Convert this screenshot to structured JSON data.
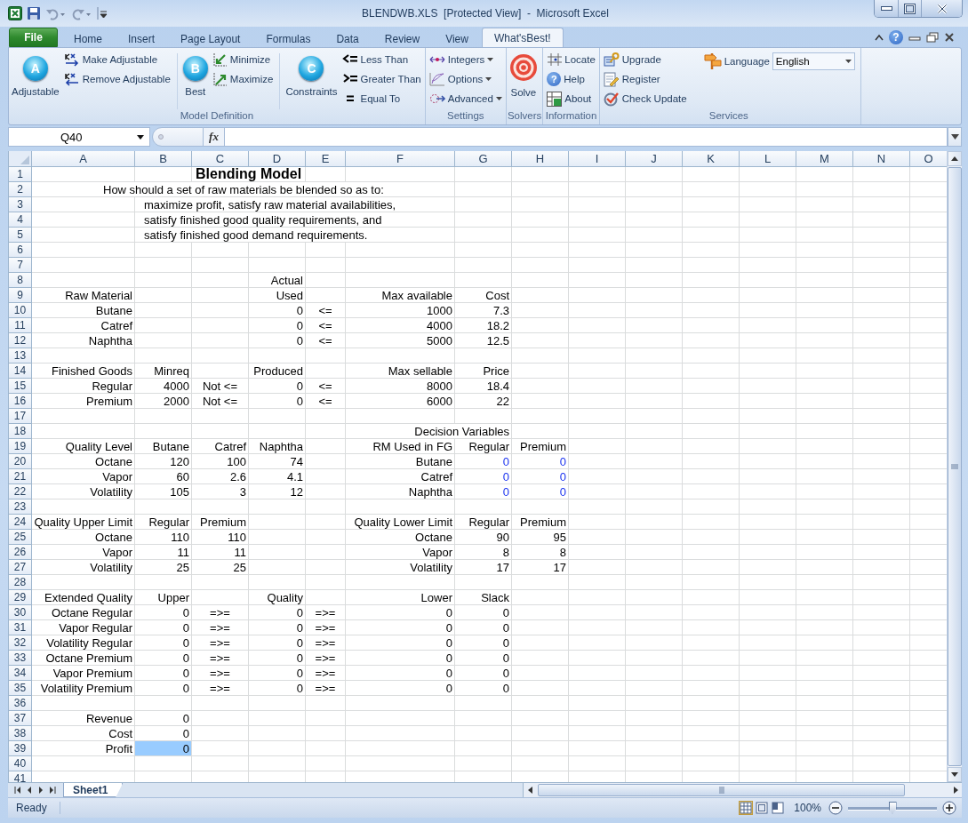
{
  "window": {
    "title": "BLENDWB.XLS  [Protected View]  -  Microsoft Excel"
  },
  "ribbon": {
    "tabs": [
      {
        "label": "File",
        "kind": "file",
        "selected": false
      },
      {
        "label": "Home",
        "kind": "tab",
        "selected": false
      },
      {
        "label": "Insert",
        "kind": "tab",
        "selected": false
      },
      {
        "label": "Page Layout",
        "kind": "tab",
        "selected": false
      },
      {
        "label": "Formulas",
        "kind": "tab",
        "selected": false
      },
      {
        "label": "Data",
        "kind": "tab",
        "selected": false
      },
      {
        "label": "Review",
        "kind": "tab",
        "selected": false
      },
      {
        "label": "View",
        "kind": "tab",
        "selected": false
      },
      {
        "label": "What'sBest!",
        "kind": "tab",
        "selected": true
      }
    ],
    "help_glyph": "?",
    "groups": [
      {
        "label": "Model Definition",
        "controls": [
          {
            "kind": "large",
            "label": "Adjustable",
            "glyph": "A"
          },
          {
            "kind": "stack",
            "buttons": [
              {
                "label": "Make Adjustable"
              },
              {
                "label": "Remove Adjustable"
              }
            ]
          },
          {
            "kind": "separator"
          },
          {
            "kind": "large",
            "label": "Best",
            "glyph": "B"
          },
          {
            "kind": "stack",
            "buttons": [
              {
                "label": "Minimize"
              },
              {
                "label": "Maximize"
              }
            ]
          },
          {
            "kind": "separator"
          },
          {
            "kind": "large",
            "label": "Constraints",
            "glyph": "C"
          },
          {
            "kind": "stack",
            "buttons": [
              {
                "label": "Less Than"
              },
              {
                "label": "Greater Than"
              },
              {
                "label": "Equal To"
              }
            ]
          }
        ]
      },
      {
        "label": "Settings",
        "controls": [
          {
            "kind": "stack",
            "buttons": [
              {
                "label": "Integers",
                "menu": true
              },
              {
                "label": "Options",
                "menu": true
              },
              {
                "label": "Advanced",
                "menu": true
              }
            ]
          }
        ]
      },
      {
        "label": "Solvers",
        "controls": [
          {
            "kind": "large",
            "label": "Solve"
          }
        ]
      },
      {
        "label": "Information",
        "controls": [
          {
            "kind": "stack",
            "buttons": [
              {
                "label": "Locate"
              },
              {
                "label": "Help",
                "glyph": "?"
              },
              {
                "label": "About"
              }
            ]
          }
        ]
      },
      {
        "label": "Services",
        "controls": [
          {
            "kind": "stack",
            "buttons": [
              {
                "label": "Upgrade"
              },
              {
                "label": "Register"
              },
              {
                "label": "Check Update"
              }
            ]
          },
          {
            "kind": "dropdown",
            "label": "Language",
            "value": "English"
          }
        ]
      }
    ]
  },
  "formula_bar": {
    "name_box": "Q40",
    "fx": "fx"
  },
  "sheet": {
    "columns": [
      "A",
      "B",
      "C",
      "D",
      "E",
      "F",
      "G",
      "H",
      "I",
      "J",
      "K",
      "L",
      "M",
      "N",
      "O"
    ],
    "rows": [
      {
        "number": "1",
        "cells": {
          "C": {
            "text": "Blending Model",
            "kind": "title"
          }
        }
      },
      {
        "number": "2",
        "cells": {
          "A": {
            "text": "How should a set of raw materials be blended so as to:",
            "kind": "intro"
          }
        }
      },
      {
        "number": "3",
        "cells": {
          "B": {
            "text": "maximize profit, satisfy raw material availabilities,",
            "kind": "note"
          }
        }
      },
      {
        "number": "4",
        "cells": {
          "B": {
            "text": "satisfy finished good quality requirements, and",
            "kind": "note"
          }
        }
      },
      {
        "number": "5",
        "cells": {
          "B": {
            "text": "satisfy finished good demand requirements.",
            "kind": "note"
          }
        }
      },
      {
        "number": "6"
      },
      {
        "number": "7"
      },
      {
        "number": "8",
        "cells": {
          "D": {
            "text": "Actual",
            "kind": "text"
          }
        }
      },
      {
        "number": "9",
        "cells": {
          "A": {
            "text": "Raw Material",
            "kind": "text"
          },
          "D": {
            "text": "Used",
            "kind": "text"
          },
          "F": {
            "text": "Max available",
            "kind": "text"
          },
          "G": {
            "text": "Cost",
            "kind": "text"
          }
        }
      },
      {
        "number": "10",
        "cells": {
          "A": {
            "text": "Butane",
            "kind": "text"
          },
          "D": {
            "text": "0",
            "kind": "text"
          },
          "E": {
            "text": "<=",
            "kind": "op"
          },
          "F": {
            "text": "1000",
            "kind": "text"
          },
          "G": {
            "text": "7.3",
            "kind": "text"
          }
        }
      },
      {
        "number": "11",
        "cells": {
          "A": {
            "text": "Catref",
            "kind": "text"
          },
          "D": {
            "text": "0",
            "kind": "text"
          },
          "E": {
            "text": "<=",
            "kind": "op"
          },
          "F": {
            "text": "4000",
            "kind": "text"
          },
          "G": {
            "text": "18.2",
            "kind": "text"
          }
        }
      },
      {
        "number": "12",
        "cells": {
          "A": {
            "text": "Naphtha",
            "kind": "text"
          },
          "D": {
            "text": "0",
            "kind": "text"
          },
          "E": {
            "text": "<=",
            "kind": "op"
          },
          "F": {
            "text": "5000",
            "kind": "text"
          },
          "G": {
            "text": "12.5",
            "kind": "text"
          }
        }
      },
      {
        "number": "13"
      },
      {
        "number": "14",
        "cells": {
          "A": {
            "text": "Finished Goods",
            "kind": "text"
          },
          "B": {
            "text": "Minreq",
            "kind": "text"
          },
          "D": {
            "text": "Produced",
            "kind": "text"
          },
          "F": {
            "text": "Max sellable",
            "kind": "text"
          },
          "G": {
            "text": "Price",
            "kind": "text"
          }
        }
      },
      {
        "number": "15",
        "cells": {
          "A": {
            "text": "Regular",
            "kind": "text"
          },
          "B": {
            "text": "4000",
            "kind": "text"
          },
          "C": {
            "text": "Not <=",
            "kind": "op"
          },
          "D": {
            "text": "0",
            "kind": "text"
          },
          "E": {
            "text": "<=",
            "kind": "op"
          },
          "F": {
            "text": "8000",
            "kind": "text"
          },
          "G": {
            "text": "18.4",
            "kind": "text"
          }
        }
      },
      {
        "number": "16",
        "cells": {
          "A": {
            "text": "Premium",
            "kind": "text"
          },
          "B": {
            "text": "2000",
            "kind": "text"
          },
          "C": {
            "text": "Not <=",
            "kind": "op"
          },
          "D": {
            "text": "0",
            "kind": "text"
          },
          "E": {
            "text": "<=",
            "kind": "op"
          },
          "F": {
            "text": "6000",
            "kind": "text"
          },
          "G": {
            "text": "22",
            "kind": "text"
          }
        }
      },
      {
        "number": "17"
      },
      {
        "number": "18",
        "cells": {
          "G": {
            "text": "Decision Variables",
            "kind": "text"
          }
        }
      },
      {
        "number": "19",
        "cells": {
          "A": {
            "text": "Quality Level",
            "kind": "text"
          },
          "B": {
            "text": "Butane",
            "kind": "text"
          },
          "C": {
            "text": "Catref",
            "kind": "text"
          },
          "D": {
            "text": "Naphtha",
            "kind": "text"
          },
          "F": {
            "text": "RM Used in FG",
            "kind": "text"
          },
          "G": {
            "text": "Regular",
            "kind": "text"
          },
          "H": {
            "text": "Premium",
            "kind": "text"
          }
        }
      },
      {
        "number": "20",
        "cells": {
          "A": {
            "text": "Octane",
            "kind": "text"
          },
          "B": {
            "text": "120",
            "kind": "text"
          },
          "C": {
            "text": "100",
            "kind": "text"
          },
          "D": {
            "text": "74",
            "kind": "text"
          },
          "F": {
            "text": "Butane",
            "kind": "text"
          },
          "G": {
            "text": "0",
            "kind": "variable"
          },
          "H": {
            "text": "0",
            "kind": "variable"
          }
        }
      },
      {
        "number": "21",
        "cells": {
          "A": {
            "text": "Vapor",
            "kind": "text"
          },
          "B": {
            "text": "60",
            "kind": "text"
          },
          "C": {
            "text": "2.6",
            "kind": "text"
          },
          "D": {
            "text": "4.1",
            "kind": "text"
          },
          "F": {
            "text": "Catref",
            "kind": "text"
          },
          "G": {
            "text": "0",
            "kind": "variable"
          },
          "H": {
            "text": "0",
            "kind": "variable"
          }
        }
      },
      {
        "number": "22",
        "cells": {
          "A": {
            "text": "Volatility",
            "kind": "text"
          },
          "B": {
            "text": "105",
            "kind": "text"
          },
          "C": {
            "text": "3",
            "kind": "text"
          },
          "D": {
            "text": "12",
            "kind": "text"
          },
          "F": {
            "text": "Naphtha",
            "kind": "text"
          },
          "G": {
            "text": "0",
            "kind": "variable"
          },
          "H": {
            "text": "0",
            "kind": "variable"
          }
        }
      },
      {
        "number": "23"
      },
      {
        "number": "24",
        "cells": {
          "A": {
            "text": "Quality Upper Limit",
            "kind": "text"
          },
          "B": {
            "text": "Regular",
            "kind": "text"
          },
          "C": {
            "text": "Premium",
            "kind": "text"
          },
          "F": {
            "text": "Quality Lower Limit",
            "kind": "text"
          },
          "G": {
            "text": "Regular",
            "kind": "text"
          },
          "H": {
            "text": "Premium",
            "kind": "text"
          }
        }
      },
      {
        "number": "25",
        "cells": {
          "A": {
            "text": "Octane",
            "kind": "text"
          },
          "B": {
            "text": "110",
            "kind": "text"
          },
          "C": {
            "text": "110",
            "kind": "text"
          },
          "F": {
            "text": "Octane",
            "kind": "text"
          },
          "G": {
            "text": "90",
            "kind": "text"
          },
          "H": {
            "text": "95",
            "kind": "text"
          }
        }
      },
      {
        "number": "26",
        "cells": {
          "A": {
            "text": "Vapor",
            "kind": "text"
          },
          "B": {
            "text": "11",
            "kind": "text"
          },
          "C": {
            "text": "11",
            "kind": "text"
          },
          "F": {
            "text": "Vapor",
            "kind": "text"
          },
          "G": {
            "text": "8",
            "kind": "text"
          },
          "H": {
            "text": "8",
            "kind": "text"
          }
        }
      },
      {
        "number": "27",
        "cells": {
          "A": {
            "text": "Volatility",
            "kind": "text"
          },
          "B": {
            "text": "25",
            "kind": "text"
          },
          "C": {
            "text": "25",
            "kind": "text"
          },
          "F": {
            "text": "Volatility",
            "kind": "text"
          },
          "G": {
            "text": "17",
            "kind": "text"
          },
          "H": {
            "text": "17",
            "kind": "text"
          }
        }
      },
      {
        "number": "28"
      },
      {
        "number": "29",
        "cells": {
          "A": {
            "text": "Extended Quality",
            "kind": "text"
          },
          "B": {
            "text": "Upper",
            "kind": "text"
          },
          "D": {
            "text": "Quality",
            "kind": "text"
          },
          "F": {
            "text": "Lower",
            "kind": "text"
          },
          "G": {
            "text": "Slack",
            "kind": "text"
          }
        }
      },
      {
        "number": "30",
        "cells": {
          "A": {
            "text": "Octane Regular",
            "kind": "text"
          },
          "B": {
            "text": "0",
            "kind": "text"
          },
          "C": {
            "text": "=>=",
            "kind": "op"
          },
          "D": {
            "text": "0",
            "kind": "text"
          },
          "E": {
            "text": "=>=",
            "kind": "op"
          },
          "F": {
            "text": "0",
            "kind": "text"
          },
          "G": {
            "text": "0",
            "kind": "text"
          }
        }
      },
      {
        "number": "31",
        "cells": {
          "A": {
            "text": "Vapor Regular",
            "kind": "text"
          },
          "B": {
            "text": "0",
            "kind": "text"
          },
          "C": {
            "text": "=>=",
            "kind": "op"
          },
          "D": {
            "text": "0",
            "kind": "text"
          },
          "E": {
            "text": "=>=",
            "kind": "op"
          },
          "F": {
            "text": "0",
            "kind": "text"
          },
          "G": {
            "text": "0",
            "kind": "text"
          }
        }
      },
      {
        "number": "32",
        "cells": {
          "A": {
            "text": "Volatility Regular",
            "kind": "text"
          },
          "B": {
            "text": "0",
            "kind": "text"
          },
          "C": {
            "text": "=>=",
            "kind": "op"
          },
          "D": {
            "text": "0",
            "kind": "text"
          },
          "E": {
            "text": "=>=",
            "kind": "op"
          },
          "F": {
            "text": "0",
            "kind": "text"
          },
          "G": {
            "text": "0",
            "kind": "text"
          }
        }
      },
      {
        "number": "33",
        "cells": {
          "A": {
            "text": "Octane Premium",
            "kind": "text"
          },
          "B": {
            "text": "0",
            "kind": "text"
          },
          "C": {
            "text": "=>=",
            "kind": "op"
          },
          "D": {
            "text": "0",
            "kind": "text"
          },
          "E": {
            "text": "=>=",
            "kind": "op"
          },
          "F": {
            "text": "0",
            "kind": "text"
          },
          "G": {
            "text": "0",
            "kind": "text"
          }
        }
      },
      {
        "number": "34",
        "cells": {
          "A": {
            "text": "Vapor Premium",
            "kind": "text"
          },
          "B": {
            "text": "0",
            "kind": "text"
          },
          "C": {
            "text": "=>=",
            "kind": "op"
          },
          "D": {
            "text": "0",
            "kind": "text"
          },
          "E": {
            "text": "=>=",
            "kind": "op"
          },
          "F": {
            "text": "0",
            "kind": "text"
          },
          "G": {
            "text": "0",
            "kind": "text"
          }
        }
      },
      {
        "number": "35",
        "cells": {
          "A": {
            "text": "Volatility Premium",
            "kind": "text"
          },
          "B": {
            "text": "0",
            "kind": "text"
          },
          "C": {
            "text": "=>=",
            "kind": "op"
          },
          "D": {
            "text": "0",
            "kind": "text"
          },
          "E": {
            "text": "=>=",
            "kind": "op"
          },
          "F": {
            "text": "0",
            "kind": "text"
          },
          "G": {
            "text": "0",
            "kind": "text"
          }
        }
      },
      {
        "number": "36"
      },
      {
        "number": "37",
        "cells": {
          "A": {
            "text": "Revenue",
            "kind": "text"
          },
          "B": {
            "text": "0",
            "kind": "text"
          }
        }
      },
      {
        "number": "38",
        "cells": {
          "A": {
            "text": "Cost",
            "kind": "text"
          },
          "B": {
            "text": "0",
            "kind": "text"
          }
        }
      },
      {
        "number": "39",
        "cells": {
          "A": {
            "text": "Profit",
            "kind": "text"
          },
          "B": {
            "text": "0",
            "kind": "text",
            "color": "#99ccff"
          }
        }
      },
      {
        "number": "40"
      },
      {
        "number": "41"
      }
    ]
  },
  "sheet_tabs": [
    {
      "label": "Sheet1",
      "selected": true
    }
  ],
  "status_bar": {
    "status": "Ready",
    "views": [
      {
        "selected": true
      },
      {
        "selected": false
      },
      {
        "selected": false
      }
    ],
    "zoom": {
      "label": "100%",
      "level": 0.5
    }
  }
}
